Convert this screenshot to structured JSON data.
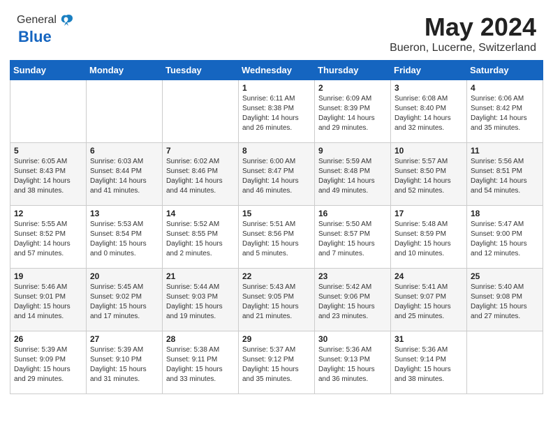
{
  "header": {
    "logo_general": "General",
    "logo_blue": "Blue",
    "main_title": "May 2024",
    "subtitle": "Bueron, Lucerne, Switzerland"
  },
  "weekdays": [
    "Sunday",
    "Monday",
    "Tuesday",
    "Wednesday",
    "Thursday",
    "Friday",
    "Saturday"
  ],
  "weeks": [
    [
      {
        "day": "",
        "info": ""
      },
      {
        "day": "",
        "info": ""
      },
      {
        "day": "",
        "info": ""
      },
      {
        "day": "1",
        "info": "Sunrise: 6:11 AM\nSunset: 8:38 PM\nDaylight: 14 hours\nand 26 minutes."
      },
      {
        "day": "2",
        "info": "Sunrise: 6:09 AM\nSunset: 8:39 PM\nDaylight: 14 hours\nand 29 minutes."
      },
      {
        "day": "3",
        "info": "Sunrise: 6:08 AM\nSunset: 8:40 PM\nDaylight: 14 hours\nand 32 minutes."
      },
      {
        "day": "4",
        "info": "Sunrise: 6:06 AM\nSunset: 8:42 PM\nDaylight: 14 hours\nand 35 minutes."
      }
    ],
    [
      {
        "day": "5",
        "info": "Sunrise: 6:05 AM\nSunset: 8:43 PM\nDaylight: 14 hours\nand 38 minutes."
      },
      {
        "day": "6",
        "info": "Sunrise: 6:03 AM\nSunset: 8:44 PM\nDaylight: 14 hours\nand 41 minutes."
      },
      {
        "day": "7",
        "info": "Sunrise: 6:02 AM\nSunset: 8:46 PM\nDaylight: 14 hours\nand 44 minutes."
      },
      {
        "day": "8",
        "info": "Sunrise: 6:00 AM\nSunset: 8:47 PM\nDaylight: 14 hours\nand 46 minutes."
      },
      {
        "day": "9",
        "info": "Sunrise: 5:59 AM\nSunset: 8:48 PM\nDaylight: 14 hours\nand 49 minutes."
      },
      {
        "day": "10",
        "info": "Sunrise: 5:57 AM\nSunset: 8:50 PM\nDaylight: 14 hours\nand 52 minutes."
      },
      {
        "day": "11",
        "info": "Sunrise: 5:56 AM\nSunset: 8:51 PM\nDaylight: 14 hours\nand 54 minutes."
      }
    ],
    [
      {
        "day": "12",
        "info": "Sunrise: 5:55 AM\nSunset: 8:52 PM\nDaylight: 14 hours\nand 57 minutes."
      },
      {
        "day": "13",
        "info": "Sunrise: 5:53 AM\nSunset: 8:54 PM\nDaylight: 15 hours\nand 0 minutes."
      },
      {
        "day": "14",
        "info": "Sunrise: 5:52 AM\nSunset: 8:55 PM\nDaylight: 15 hours\nand 2 minutes."
      },
      {
        "day": "15",
        "info": "Sunrise: 5:51 AM\nSunset: 8:56 PM\nDaylight: 15 hours\nand 5 minutes."
      },
      {
        "day": "16",
        "info": "Sunrise: 5:50 AM\nSunset: 8:57 PM\nDaylight: 15 hours\nand 7 minutes."
      },
      {
        "day": "17",
        "info": "Sunrise: 5:48 AM\nSunset: 8:59 PM\nDaylight: 15 hours\nand 10 minutes."
      },
      {
        "day": "18",
        "info": "Sunrise: 5:47 AM\nSunset: 9:00 PM\nDaylight: 15 hours\nand 12 minutes."
      }
    ],
    [
      {
        "day": "19",
        "info": "Sunrise: 5:46 AM\nSunset: 9:01 PM\nDaylight: 15 hours\nand 14 minutes."
      },
      {
        "day": "20",
        "info": "Sunrise: 5:45 AM\nSunset: 9:02 PM\nDaylight: 15 hours\nand 17 minutes."
      },
      {
        "day": "21",
        "info": "Sunrise: 5:44 AM\nSunset: 9:03 PM\nDaylight: 15 hours\nand 19 minutes."
      },
      {
        "day": "22",
        "info": "Sunrise: 5:43 AM\nSunset: 9:05 PM\nDaylight: 15 hours\nand 21 minutes."
      },
      {
        "day": "23",
        "info": "Sunrise: 5:42 AM\nSunset: 9:06 PM\nDaylight: 15 hours\nand 23 minutes."
      },
      {
        "day": "24",
        "info": "Sunrise: 5:41 AM\nSunset: 9:07 PM\nDaylight: 15 hours\nand 25 minutes."
      },
      {
        "day": "25",
        "info": "Sunrise: 5:40 AM\nSunset: 9:08 PM\nDaylight: 15 hours\nand 27 minutes."
      }
    ],
    [
      {
        "day": "26",
        "info": "Sunrise: 5:39 AM\nSunset: 9:09 PM\nDaylight: 15 hours\nand 29 minutes."
      },
      {
        "day": "27",
        "info": "Sunrise: 5:39 AM\nSunset: 9:10 PM\nDaylight: 15 hours\nand 31 minutes."
      },
      {
        "day": "28",
        "info": "Sunrise: 5:38 AM\nSunset: 9:11 PM\nDaylight: 15 hours\nand 33 minutes."
      },
      {
        "day": "29",
        "info": "Sunrise: 5:37 AM\nSunset: 9:12 PM\nDaylight: 15 hours\nand 35 minutes."
      },
      {
        "day": "30",
        "info": "Sunrise: 5:36 AM\nSunset: 9:13 PM\nDaylight: 15 hours\nand 36 minutes."
      },
      {
        "day": "31",
        "info": "Sunrise: 5:36 AM\nSunset: 9:14 PM\nDaylight: 15 hours\nand 38 minutes."
      },
      {
        "day": "",
        "info": ""
      }
    ]
  ]
}
